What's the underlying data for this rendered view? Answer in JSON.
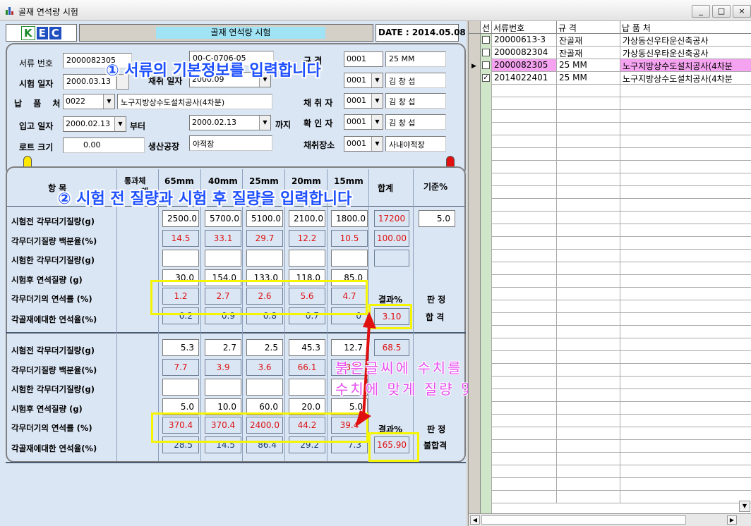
{
  "window": {
    "title": "골재 연석량 시험",
    "min": "_",
    "max": "□",
    "close": "×"
  },
  "header": {
    "logo": [
      "K",
      "E",
      "C"
    ],
    "title": "골재 연석량 시험",
    "date": "DATE : 2014.05.08"
  },
  "info": {
    "doc_no_label": "서류 번호",
    "doc_no": "2000082305",
    "doc_no2": "00-C-0706-05",
    "test_date_label": "시험 일자",
    "test_date": "2000.03.13",
    "collect_date_label": "채취 일자",
    "collect_date": "2000.09",
    "spec_label": "규 격",
    "spec_code": "0001",
    "spec_value": "25 MM",
    "tester_code": "0001",
    "tester_name": "김 창 섭",
    "vendor_label": "납 품 처",
    "vendor_code": "0022",
    "vendor_name": "노구지방상수도설치공사(4차분)",
    "collector_label": "채 취 자",
    "collector_code": "0001",
    "collector_name": "김 창 섭",
    "in_date_label": "입고 일자",
    "in_date_from": "2000.02.13",
    "from_label": "부터",
    "in_date_to": "2000.02.13",
    "to_label": "까지",
    "checker_label": "확 인 자",
    "checker_code": "0001",
    "checker_name": "김 창 섭",
    "lot_label": "로트 크기",
    "lot_value": "0.00",
    "plant_label": "생산공장",
    "plant_value": "야적장",
    "place_label": "채취장소",
    "place_code": "0001",
    "place_value": "사내야적장"
  },
  "table": {
    "headers": {
      "item": "항   목",
      "pass": "통과체",
      "pass2": "체",
      "c65": "65mm",
      "c40": "40mm",
      "c25": "25mm",
      "c20": "20mm",
      "c15": "15mm",
      "sum": "합계",
      "std": "기준%"
    },
    "std_value": "5.0",
    "s1": {
      "labels": [
        "시험전 각무더기질량(g)",
        "각무더기질량 백분율(%)",
        "시험한 각무더기질량(g)",
        "시험후 연석질량   (g)",
        "각무더기의 연석률 (%)",
        "각골재에대한 연석율(%)"
      ],
      "before": [
        "2500.0",
        "5700.0",
        "5100.0",
        "2100.0",
        "1800.0"
      ],
      "before_sum": "17200",
      "pct": [
        "14.5",
        "33.1",
        "29.7",
        "12.2",
        "10.5"
      ],
      "pct_sum": "100.00",
      "after": [
        "30.0",
        "154.0",
        "133.0",
        "118.0",
        "85.0"
      ],
      "rate": [
        "1.2",
        "2.7",
        "2.6",
        "5.6",
        "4.7"
      ],
      "total": [
        "0.2",
        "0.9",
        "0.8",
        "0.7",
        "0"
      ],
      "result_label": "결과%",
      "result": "3.10",
      "judge_label": "판 정",
      "judge": "합 격"
    },
    "s2": {
      "labels": [
        "시험전 각무더기질량(g)",
        "각무더기질량 백분율(%)",
        "시험한 각무더기질량(g)",
        "시험후 연석질량   (g)",
        "각무더기의 연석률 (%)",
        "각골재에대한 연석율(%)"
      ],
      "before": [
        "5.3",
        "2.7",
        "2.5",
        "45.3",
        "12.7"
      ],
      "before_sum": "68.5",
      "pct": [
        "7.7",
        "3.9",
        "3.6",
        "66.1",
        "18.5"
      ],
      "after": [
        "5.0",
        "10.0",
        "60.0",
        "20.0",
        "5.0"
      ],
      "rate": [
        "370.4",
        "370.4",
        "2400.0",
        "44.2",
        "39.4"
      ],
      "total": [
        "28.5",
        "14.5",
        "86.4",
        "29.2",
        "7.3"
      ],
      "result_label": "결과%",
      "result": "165.90",
      "judge_label": "판 정",
      "judge": "불합격"
    }
  },
  "overlay": {
    "step1": "① 서류의 기본정보를 입력합니다",
    "step2": "② 시험 전 질량과 시험 후 질량을 입력합니다",
    "note1": "붉은글씨에 수치를 직접 입력하실 경우",
    "note2": "수치에 맞게 질량 및 백분률이 역산됩니다."
  },
  "grid": {
    "columns": [
      "선",
      "서류번호",
      "규 격",
      "납 품 처"
    ],
    "rows": [
      {
        "checked": false,
        "doc": "20000613-3",
        "spec": "잔골재",
        "vendor": "가상동신우타운신축공사",
        "selected": false
      },
      {
        "checked": false,
        "doc": "2000082304",
        "spec": "잔골재",
        "vendor": "가상동신우타운신축공사",
        "selected": false
      },
      {
        "checked": false,
        "doc": "2000082305",
        "spec": "25 MM",
        "vendor": "노구지방상수도설치공사(4차분",
        "selected": true
      },
      {
        "checked": true,
        "doc": "2014022401",
        "spec": "25 MM",
        "vendor": "노구지방상수도설치공사(4차분",
        "selected": false
      }
    ]
  },
  "colors": {
    "accent": "#1e50ff",
    "highlight": "#f5f500",
    "selected_row": "#f5a3f0",
    "red": "#d11"
  }
}
